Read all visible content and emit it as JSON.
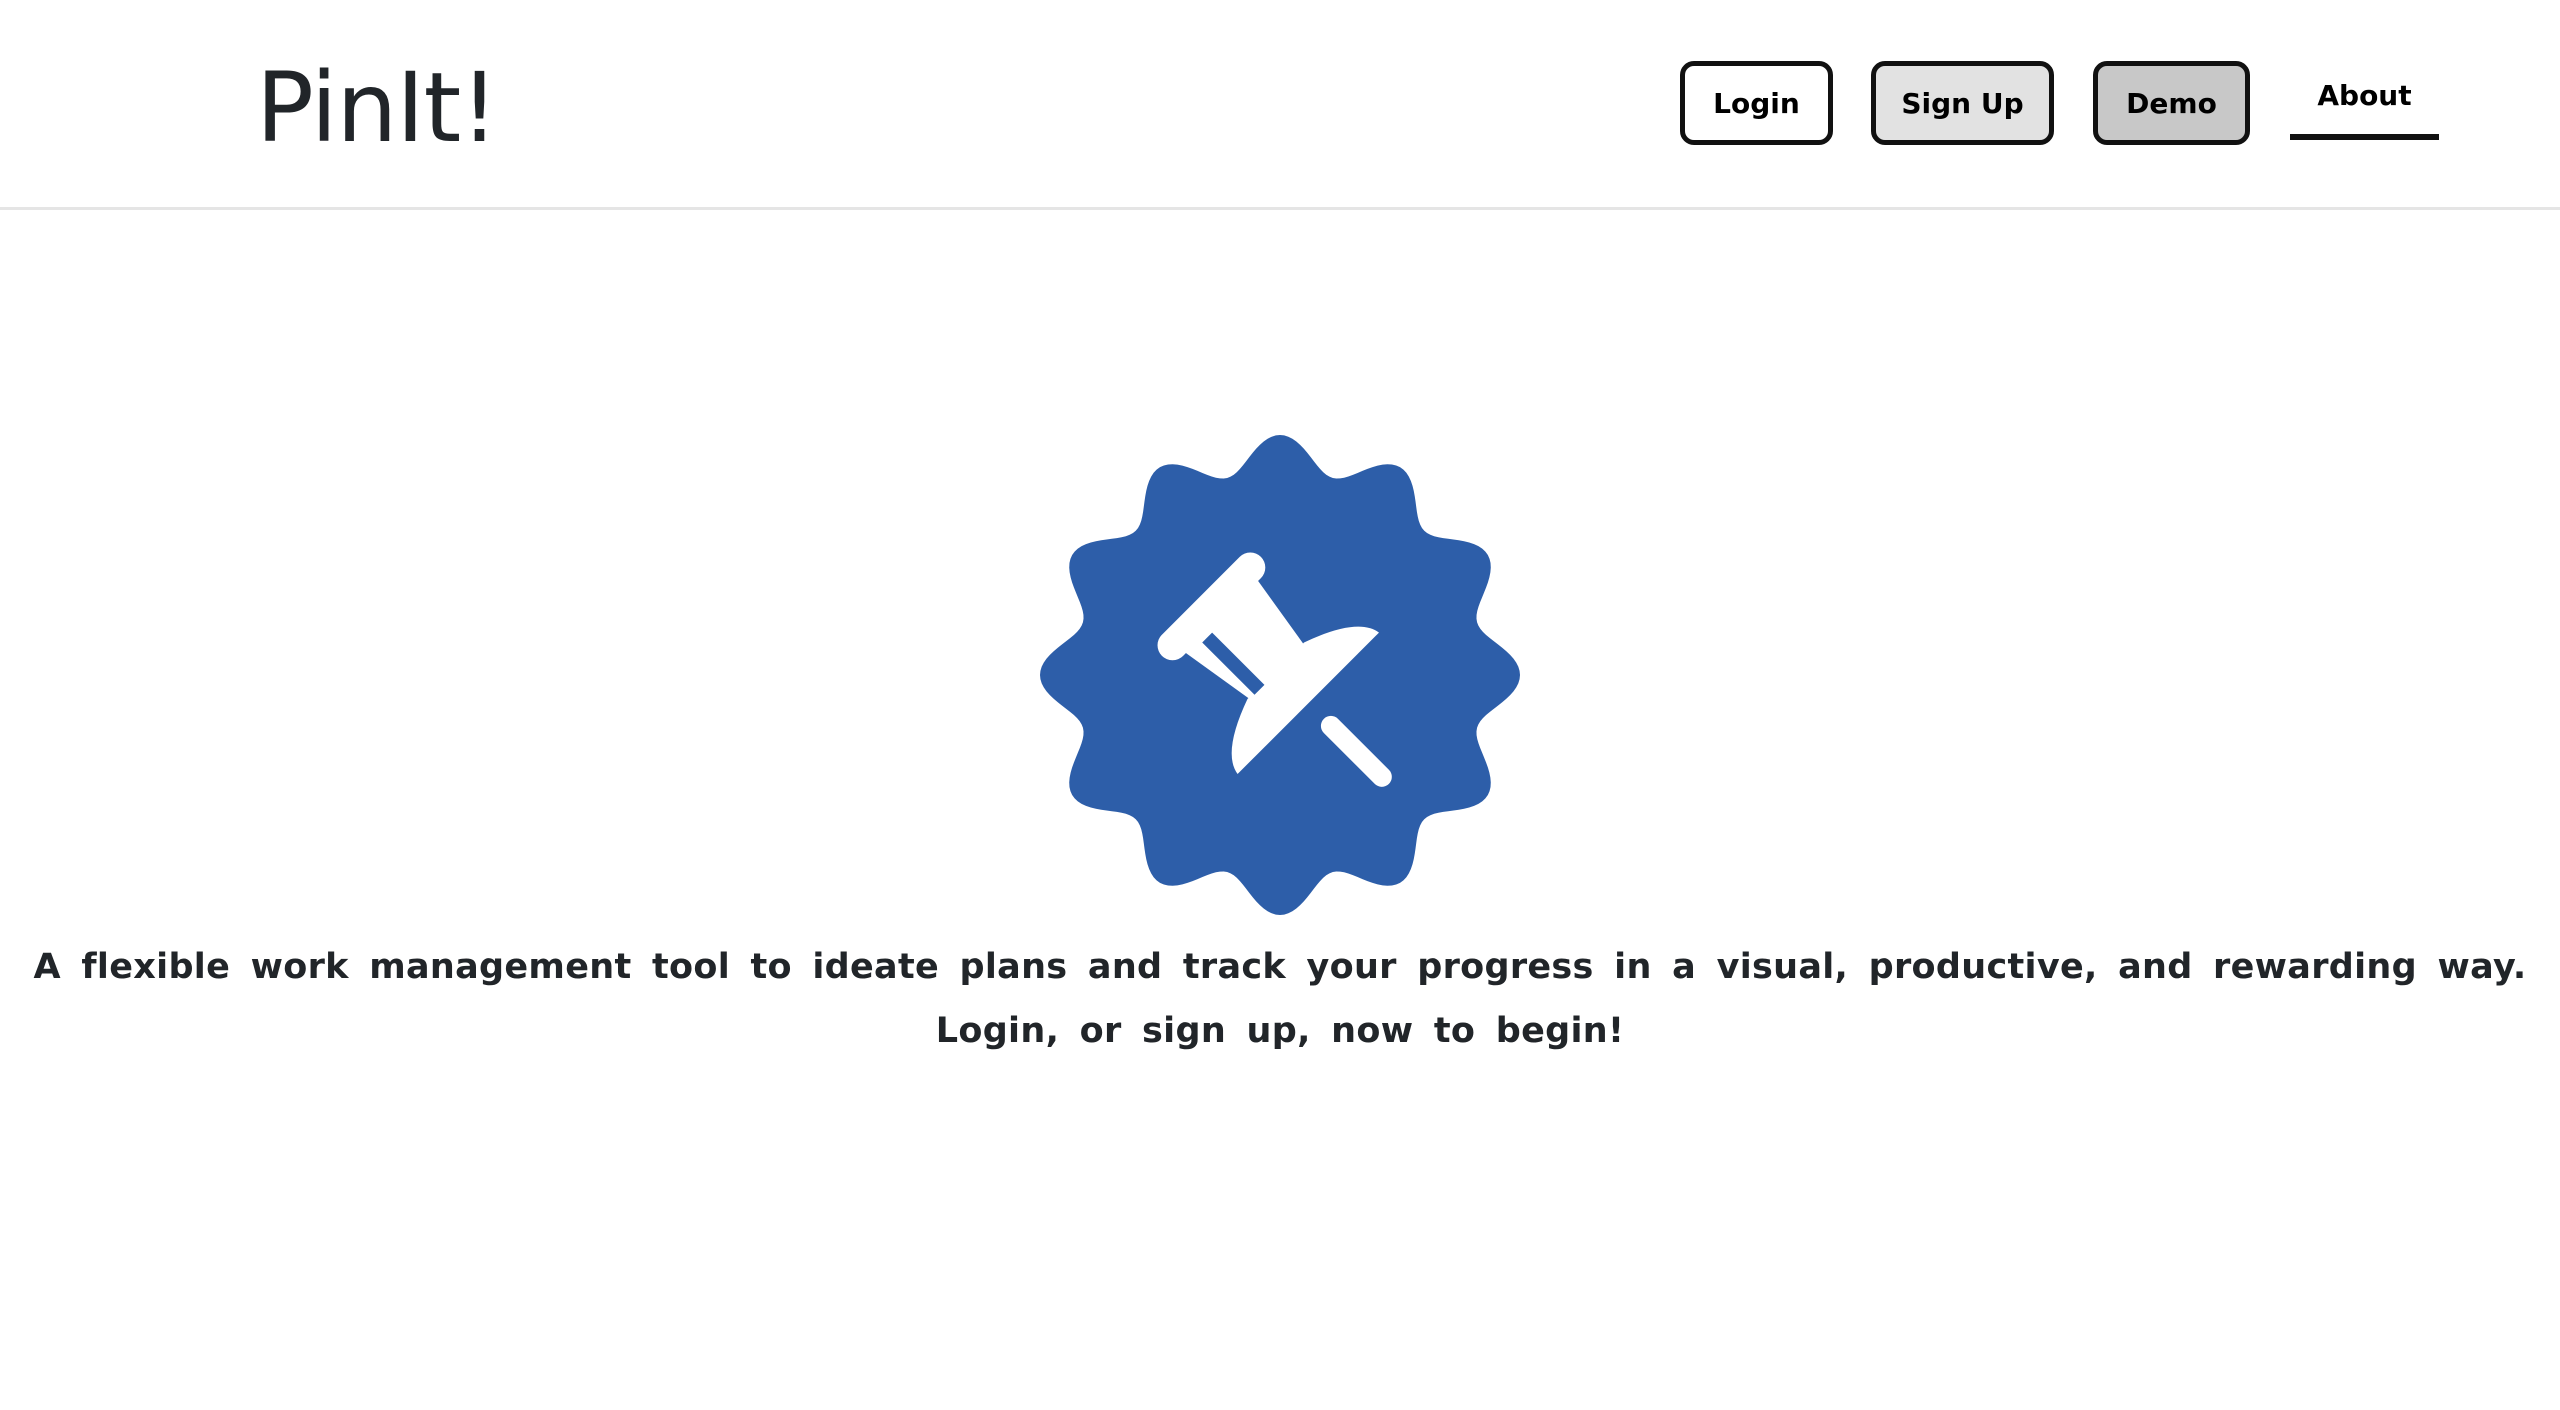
{
  "brand": {
    "name": "PinIt!"
  },
  "nav": {
    "login_label": "Login",
    "signup_label": "Sign Up",
    "demo_label": "Demo",
    "about_label": "About"
  },
  "hero": {
    "icon": "pushpin-badge-icon",
    "line1": "A flexible work management tool to ideate plans and track your progress in a visual, productive, and rewarding way.",
    "line2": "Login, or sign up, now to begin!"
  },
  "colors": {
    "badge_blue": "#2d5ea9",
    "signup_bg": "#e2e2e2",
    "demo_bg": "#c8c8c8",
    "login_bg": "#ffffff"
  }
}
